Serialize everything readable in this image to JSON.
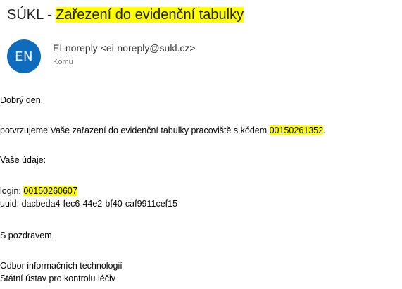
{
  "email": {
    "subject_prefix": "SÚKL - ",
    "subject_highlight": "Zařezení do evidenční tabulky",
    "avatar_initials": "EN",
    "sender": "EI-noreply <ei-noreply@sukl.cz>",
    "to_label": "Komu",
    "greeting": "Dobrý den,",
    "confirm_text": "potvrzujeme Vaše zařazení do evidenční tabulky pracoviště s kódem ",
    "confirm_code": "00150261352",
    "confirm_end": ".",
    "details_label": "Vaše údaje:",
    "login_label": "login: ",
    "login_value": "00150260607",
    "uuid_line": "uuid: dacbeda4-fec6-44e2-bf40-caf9911cef15",
    "closing": "S pozdravem",
    "signature_line1": "Odbor informačních technologií",
    "signature_line2": "Státní ústav pro kontrolu léčiv"
  },
  "colors": {
    "highlight": "#ffff00",
    "avatar_bg": "#0f6cbd"
  }
}
